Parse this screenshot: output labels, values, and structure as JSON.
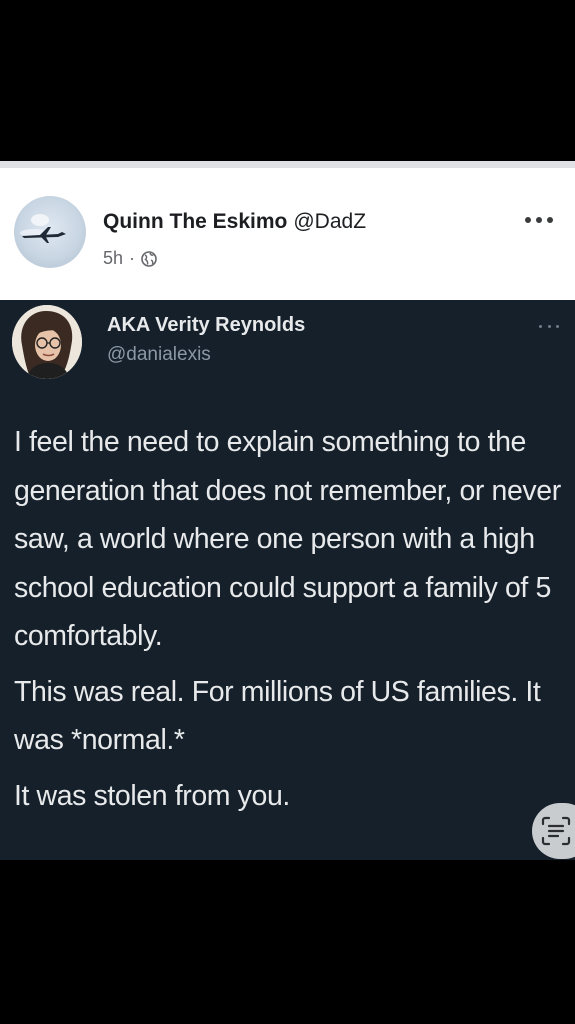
{
  "fb_post": {
    "author_name": "Quinn The Eskimo",
    "author_handle": "@DadZ",
    "time": "5h",
    "separator": "·",
    "privacy_icon": "globe-icon",
    "more_icon": "more-horizontal-icon"
  },
  "tweet": {
    "display_name": "AKA Verity Reynolds",
    "handle": "@danialexis",
    "more_icon": "more-horizontal-icon",
    "paragraphs": [
      "I feel the need to explain something to the generation that does not remember, or never saw, a world where one person with a high school education could support a family of 5 comfortably.",
      "This was real. For millions of US families. It was *normal.*",
      "It was stolen from you."
    ]
  },
  "overlay": {
    "scan_icon": "text-scan-icon"
  },
  "colors": {
    "letterbox": "#000000",
    "fb_background": "#ffffff",
    "tweet_background": "#15202b",
    "tweet_text": "#e7e9ea",
    "tweet_secondary": "#8b98a5"
  }
}
